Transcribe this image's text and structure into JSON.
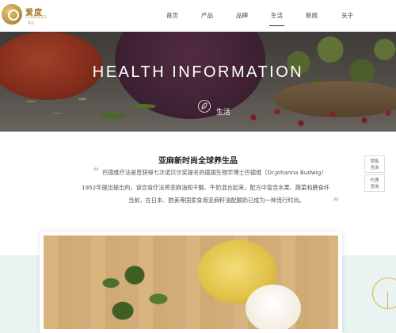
{
  "logo": {
    "name_cn": "爱度",
    "name_en": "FLAXSEED",
    "sub": "食品"
  },
  "nav": {
    "items": [
      {
        "label": "首页"
      },
      {
        "label": "产品"
      },
      {
        "label": "品牌"
      },
      {
        "label": "生活",
        "active": true
      },
      {
        "label": "新闻"
      },
      {
        "label": "关于"
      }
    ]
  },
  "hero": {
    "title": "HEALTH INFORMATION",
    "subtitle": "生活"
  },
  "article": {
    "title": "亚麻新时尚全球养生品",
    "lines": [
      "巴德维疗法是曾获得七次诺贝尔奖提名的德国生物学博士巴德维（Dr.Johanna Budwig）",
      "1952年提出提出的，该饮食疗法将亚麻油和干酪、牛奶混合起来，配方中富含水果、蔬菜和膳食纤",
      "当前，在日本、欧美等国家食用亚麻籽油配酸奶已成为一种流行时尚。"
    ]
  },
  "side": {
    "sales_consult": "销售咨询",
    "agent_consult": "代理咨询"
  },
  "colors": {
    "accent_gold": "#c9a03c",
    "band": "#e9f3f2"
  }
}
